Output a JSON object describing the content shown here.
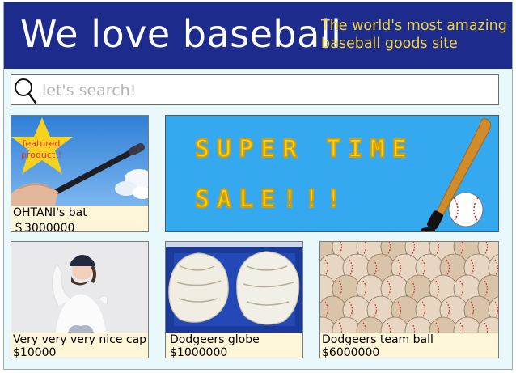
{
  "header": {
    "title": "We love baseball",
    "tagline": "The world's most amazing baseball goods site"
  },
  "search": {
    "placeholder": "let's search!",
    "icon": "search-icon"
  },
  "featured": {
    "badge": "featured product !",
    "name": "OHTANI's bat",
    "price": "＄3000000"
  },
  "banner": {
    "line1": "SUPER TIME",
    "line2": "SALE!!!"
  },
  "products": [
    {
      "name": "Very very very nice cap",
      "price": "$10000"
    },
    {
      "name": "Dodgeers globe",
      "price": "$1000000"
    },
    {
      "name": "Dodgeers team ball",
      "price": "$6000000"
    }
  ],
  "colors": {
    "header_bg": "#1c2b8c",
    "tagline": "#f2d23c",
    "banner_bg": "#34a9f0",
    "card_label_bg": "#fff5d9",
    "page_bg": "#e8f8fb"
  }
}
